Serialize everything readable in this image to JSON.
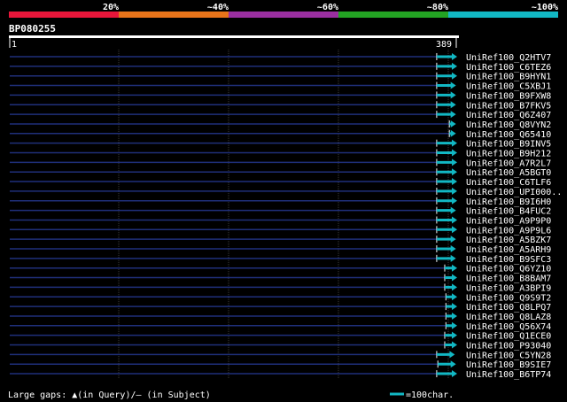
{
  "identity_scale": {
    "labels": [
      "20%",
      "~40%",
      "~60%",
      "~80%",
      "~100%"
    ],
    "colors": [
      "#e8163a",
      "#e8741a",
      "#9a2fa0",
      "#23a323",
      "#12b8c4"
    ]
  },
  "query": {
    "id": "BP080255",
    "start": "1",
    "end": "389"
  },
  "hits": [
    {
      "name": "UniRef100_Q2HTV7",
      "start": 372,
      "end": 389
    },
    {
      "name": "UniRef100_C6TEZ6",
      "start": 372,
      "end": 389
    },
    {
      "name": "UniRef100_B9HYN1",
      "start": 372,
      "end": 389
    },
    {
      "name": "UniRef100_C5XBJ1",
      "start": 372,
      "end": 388
    },
    {
      "name": "UniRef100_B9FXW8",
      "start": 372,
      "end": 388
    },
    {
      "name": "UniRef100_B7FKV5",
      "start": 372,
      "end": 388
    },
    {
      "name": "UniRef100_Q6Z407",
      "start": 372,
      "end": 388
    },
    {
      "name": "UniRef100_Q8VYN2",
      "start": 383,
      "end": 388
    },
    {
      "name": "UniRef100_Q65410",
      "start": 383,
      "end": 388
    },
    {
      "name": "UniRef100_B9INV5",
      "start": 372,
      "end": 389
    },
    {
      "name": "UniRef100_B9H212",
      "start": 372,
      "end": 389
    },
    {
      "name": "UniRef100_A7R2L7",
      "start": 372,
      "end": 389
    },
    {
      "name": "UniRef100_A5BGT0",
      "start": 372,
      "end": 389
    },
    {
      "name": "UniRef100_C6TLF6",
      "start": 372,
      "end": 389
    },
    {
      "name": "UniRef100_UPI000..",
      "start": 372,
      "end": 389
    },
    {
      "name": "UniRef100_B9I6H0",
      "start": 372,
      "end": 389
    },
    {
      "name": "UniRef100_B4FUC2",
      "start": 372,
      "end": 388
    },
    {
      "name": "UniRef100_A9P9P0",
      "start": 372,
      "end": 389
    },
    {
      "name": "UniRef100_A9P9L6",
      "start": 372,
      "end": 389
    },
    {
      "name": "UniRef100_A5BZK7",
      "start": 372,
      "end": 388
    },
    {
      "name": "UniRef100_A5ARH9",
      "start": 372,
      "end": 388
    },
    {
      "name": "UniRef100_B9SFC3",
      "start": 372,
      "end": 388
    },
    {
      "name": "UniRef100_Q6YZ10",
      "start": 379,
      "end": 389
    },
    {
      "name": "UniRef100_B8BAM7",
      "start": 379,
      "end": 389
    },
    {
      "name": "UniRef100_A3BPI9",
      "start": 379,
      "end": 389
    },
    {
      "name": "UniRef100_Q9S9T2",
      "start": 380,
      "end": 389
    },
    {
      "name": "UniRef100_Q8LPQ7",
      "start": 380,
      "end": 389
    },
    {
      "name": "UniRef100_Q8LAZ8",
      "start": 380,
      "end": 389
    },
    {
      "name": "UniRef100_Q56X74",
      "start": 380,
      "end": 389
    },
    {
      "name": "UniRef100_Q1ECE0",
      "start": 379,
      "end": 389
    },
    {
      "name": "UniRef100_P93040",
      "start": 379,
      "end": 389
    },
    {
      "name": "UniRef100_C5YN28",
      "start": 372,
      "end": 387
    },
    {
      "name": "UniRef100_B9SIE7",
      "start": 373,
      "end": 388
    },
    {
      "name": "UniRef100_B6TP74",
      "start": 372,
      "end": 389
    }
  ],
  "legend": {
    "text": "Large gaps: ▲(in Query)/– (in Subject)",
    "scale_text": "=100char."
  }
}
